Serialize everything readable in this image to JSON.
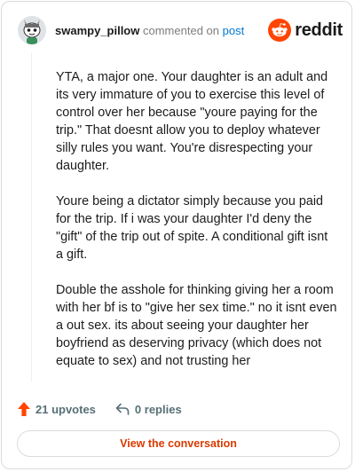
{
  "comment": {
    "author": "swampy_pillow",
    "action_text": "commented on",
    "post_link_text": "post",
    "brand_name": "reddit",
    "paragraphs": [
      "YTA, a major one. Your daughter is an adult and its very immature of you to exercise this level of control over her because \"youre paying for the trip.\" That doesnt allow you to deploy whatever silly rules you want. You're disrespecting your daughter.",
      "Youre being a dictator simply because you paid for the trip. If i was your daughter I'd deny the \"gift\" of the trip out of spite. A conditional gift isnt a gift.",
      "Double the asshole for thinking giving her a room with her bf is to \"give her sex time.\" no it isnt even a out sex. its about seeing your daughter her boyfriend as deserving privacy (which does not equate to sex) and not trusting her"
    ],
    "upvotes": "21 upvotes",
    "replies": "0 replies",
    "view_button": "View the conversation"
  },
  "icons": {
    "avatar": "snoo-avatar",
    "brand": "reddit-logo-icon",
    "upvote": "upvote-arrow-icon",
    "reply": "reply-arrow-icon"
  },
  "colors": {
    "brand_orange": "#ff4500",
    "link_blue": "#0079d3",
    "button_text": "#d93a00",
    "muted": "#576f76"
  }
}
